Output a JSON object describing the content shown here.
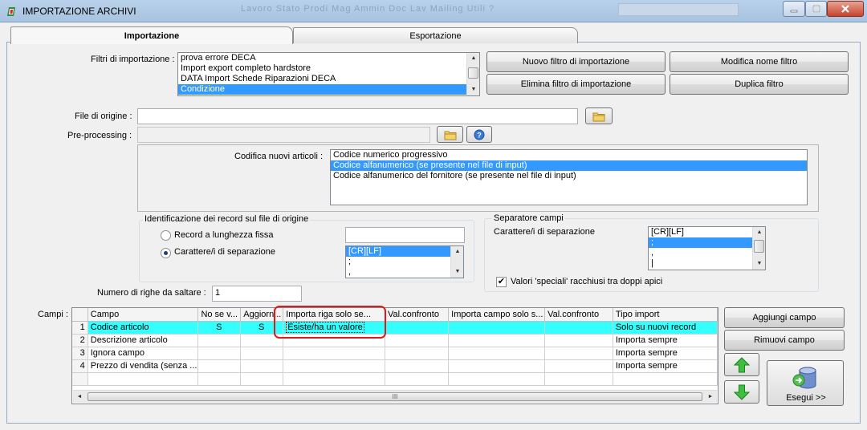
{
  "window": {
    "title": "IMPORTAZIONE ARCHIVI",
    "icon": "app-flag-icon",
    "ghost_menu": "Lavoro   Stato   Prodi   Mag   Ammin   Doc   Lav   Mailing   Utili   ?"
  },
  "tabs": [
    {
      "label": "Importazione",
      "active": true
    },
    {
      "label": "Esportazione",
      "active": false
    }
  ],
  "filters": {
    "label": "Filtri di importazione :",
    "items": [
      "prova errore DECA",
      "Import export completo hardstore",
      "DATA Import Schede Riparazioni DECA",
      "Condizione"
    ],
    "selected_index": 3
  },
  "filter_buttons": {
    "new": "Nuovo filtro di importazione",
    "rename": "Modifica nome filtro",
    "delete": "Elimina filtro di importazione",
    "duplicate": "Duplica filtro"
  },
  "source_file": {
    "label": "File di origine :",
    "value": ""
  },
  "preprocessing": {
    "label": "Pre-processing :",
    "value": ""
  },
  "article_coding": {
    "label": "Codifica nuovi articoli :",
    "items": [
      "Codice numerico progressivo",
      "Codice alfanumerico (se presente nel file di input)",
      "Codice alfanumerico del fornitore (se presente nel file di input)"
    ],
    "selected_index": 1
  },
  "record_id": {
    "title": "Identificazione dei record sul file di origine",
    "fixed_length_label": "Record a lunghezza fissa",
    "fixed_length_value": "",
    "separator_label": "Carattere/i di separazione",
    "separator_selected": true,
    "separator_items": [
      "[CR][LF]",
      ";",
      ","
    ],
    "separator_selected_index": 0
  },
  "field_separator": {
    "title": "Separatore campi",
    "chars_label": "Carattere/i di separazione",
    "items": [
      "[CR][LF]",
      ";",
      ",",
      "|"
    ],
    "selected_index": 1,
    "quotes_label": "Valori 'speciali' racchiusi tra doppi apici",
    "quotes_checked": true
  },
  "skip_rows": {
    "label": "Numero di righe da saltare  :",
    "value": "1"
  },
  "fields": {
    "label": "Campi :",
    "columns": [
      "",
      "Campo",
      "No se v...",
      "Aggiorn...",
      "Importa riga solo se...",
      "Val.confronto",
      "Importa campo solo s...",
      "Val.confronto",
      "Tipo import"
    ],
    "rows": [
      [
        "1",
        "Codice articolo",
        "S",
        "S",
        "Esiste/ha un valore",
        "",
        "",
        "",
        "Solo su nuovi record"
      ],
      [
        "2",
        "Descrizione articolo",
        "",
        "",
        "",
        "",
        "",
        "",
        "Importa sempre"
      ],
      [
        "3",
        "Ignora campo",
        "",
        "",
        "",
        "",
        "",
        "",
        "Importa sempre"
      ],
      [
        "4",
        "Prezzo di vendita (senza ...",
        "",
        "",
        "",
        "",
        "",
        "",
        "Importa sempre"
      ]
    ],
    "highlighted_row": 0,
    "scroll_thumb_label": "III"
  },
  "field_buttons": {
    "add": "Aggiungi campo",
    "remove": "Rimuovi campo",
    "execute": "Esegui >>"
  },
  "colors": {
    "selection": "#3399ff",
    "row_highlight": "#33ffff",
    "annotation": "#e01a1a"
  }
}
